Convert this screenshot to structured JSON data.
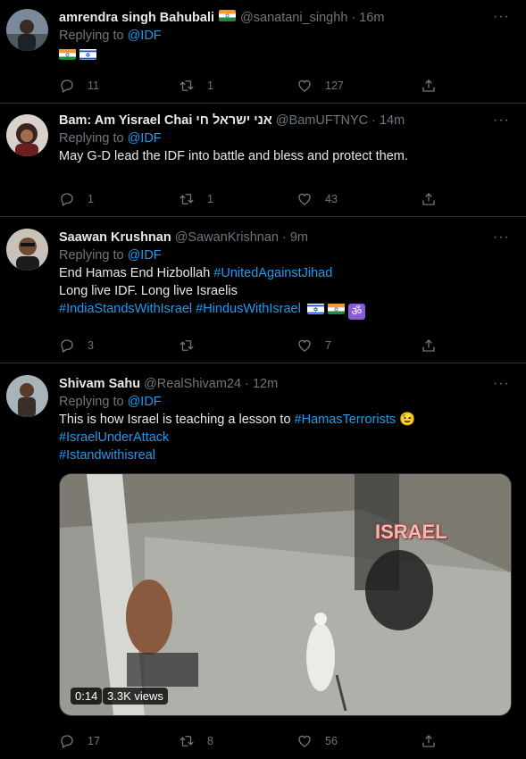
{
  "tweets": [
    {
      "name": "amrendra singh Bahubali",
      "handle": "@sanatani_singhh",
      "time": "16m",
      "replying_label": "Replying to",
      "replying_to": "@IDF",
      "reply_count": "11",
      "retweet_count": "1",
      "like_count": "127"
    },
    {
      "name": "Bam: Am Yisrael Chai אני ישראל חי",
      "handle": "@BamUFTNYC",
      "time": "14m",
      "replying_label": "Replying to",
      "replying_to": "@IDF",
      "text": "May G-D lead the IDF into battle and bless and protect them.",
      "reply_count": "1",
      "retweet_count": "1",
      "like_count": "43"
    },
    {
      "name": "Saawan Krushnan",
      "handle": "@SawanKrishnan",
      "time": "9m",
      "replying_label": "Replying to",
      "replying_to": "@IDF",
      "line1_text": "End Hamas End Hizbollah ",
      "line1_tag": "#UnitedAgainstJihad",
      "line2_text": "Long live IDF. Long live Israelis",
      "line3_tag1": "#IndiaStandsWithIsrael",
      "line3_tag2": "#HindusWithIsrael",
      "om_symbol": "ॐ",
      "reply_count": "3",
      "retweet_count": "",
      "like_count": "7"
    },
    {
      "name": "Shivam Sahu",
      "handle": "@RealShivam24",
      "time": "12m",
      "replying_label": "Replying to",
      "replying_to": "@IDF",
      "line1_text": "This is how Israel is teaching a lesson to ",
      "line1_tag": "#HamasTerrorists",
      "emoji": "😉",
      "line2_tag": "#IsraelUnderAttack",
      "line3_tag": "#Istandwithisreal",
      "video_overlay_text": "ISRAEL",
      "video_duration": "0:14",
      "video_views": "3.3K views",
      "reply_count": "17",
      "retweet_count": "8",
      "like_count": "56"
    }
  ],
  "more_label": "···",
  "colors": {
    "accent": "#1d9bf0",
    "muted": "#6e767d",
    "border": "#2f3336"
  }
}
